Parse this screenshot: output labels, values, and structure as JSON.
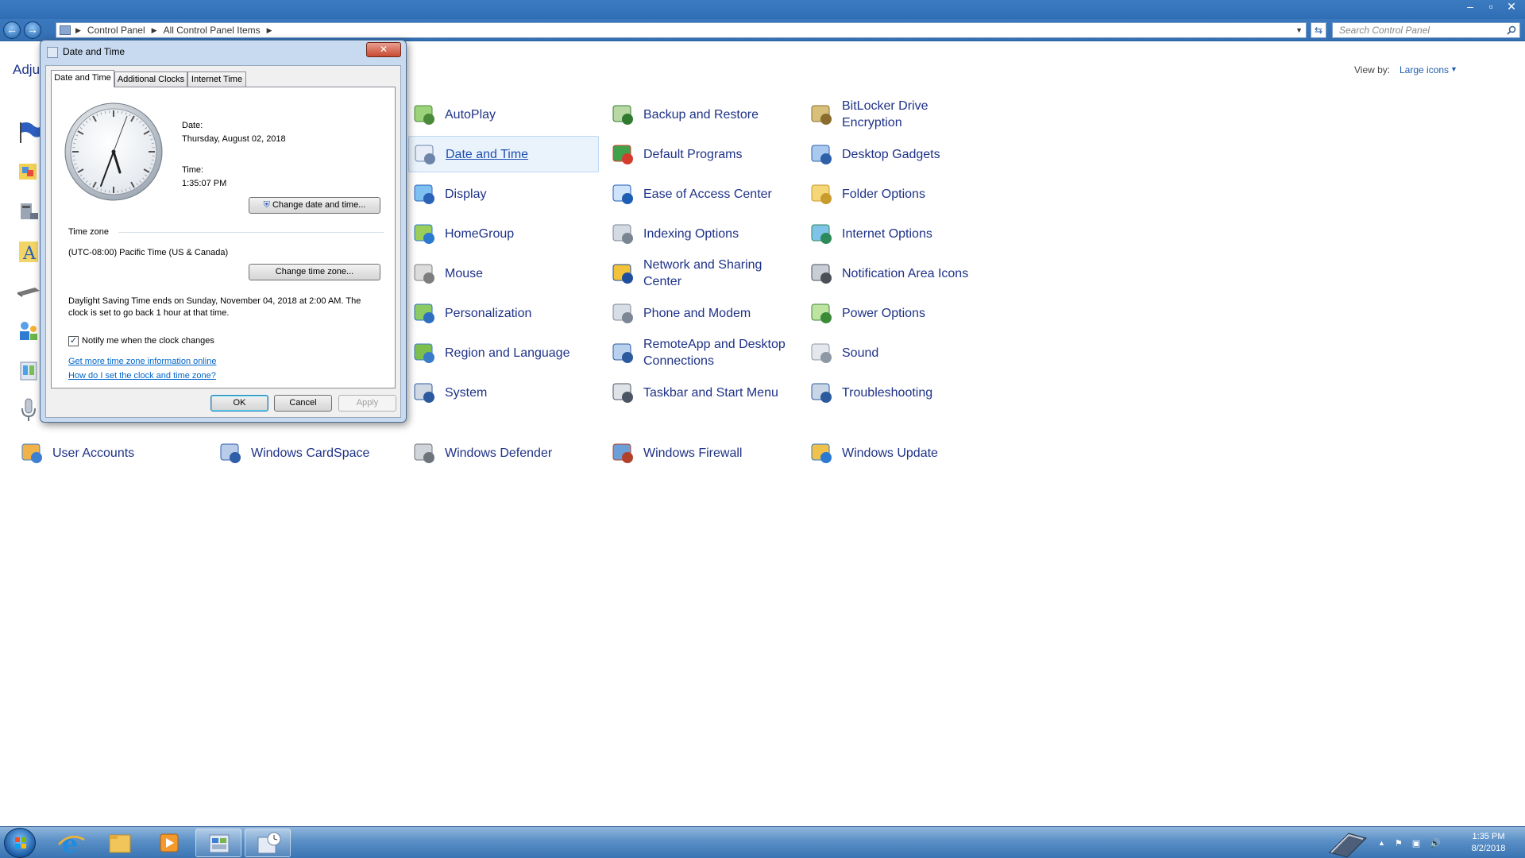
{
  "window": {
    "controls": [
      "–",
      "▫",
      "✕"
    ]
  },
  "navbar": {
    "breadcrumbs": [
      "Control Panel",
      "All Control Panel Items"
    ],
    "search_placeholder": "Search Control Panel"
  },
  "content": {
    "heading": "Adju",
    "view_by_label": "View by:",
    "view_by_value": "Large icons",
    "items": [
      {
        "label": "AutoPlay",
        "icon": "autoplay-icon"
      },
      {
        "label": "Backup and Restore",
        "icon": "backup-restore-icon"
      },
      {
        "label": "BitLocker Drive Encryption",
        "icon": "bitlocker-icon"
      },
      {
        "label": "Date and Time",
        "icon": "date-time-icon",
        "selected": true
      },
      {
        "label": "Default Programs",
        "icon": "default-programs-icon"
      },
      {
        "label": "Desktop Gadgets",
        "icon": "desktop-gadgets-icon"
      },
      {
        "label": "Display",
        "icon": "display-icon"
      },
      {
        "label": "Ease of Access Center",
        "icon": "ease-of-access-icon"
      },
      {
        "label": "Folder Options",
        "icon": "folder-options-icon"
      },
      {
        "label": "HomeGroup",
        "icon": "homegroup-icon"
      },
      {
        "label": "Indexing Options",
        "icon": "indexing-options-icon"
      },
      {
        "label": "Internet Options",
        "icon": "internet-options-icon"
      },
      {
        "label": "Mouse",
        "icon": "mouse-icon"
      },
      {
        "label": "Network and Sharing Center",
        "icon": "network-sharing-icon"
      },
      {
        "label": "Notification Area Icons",
        "icon": "notification-area-icon"
      },
      {
        "label": "Personalization",
        "icon": "personalization-icon"
      },
      {
        "label": "Phone and Modem",
        "icon": "phone-modem-icon"
      },
      {
        "label": "Power Options",
        "icon": "power-options-icon"
      },
      {
        "label": "Region and Language",
        "icon": "region-language-icon"
      },
      {
        "label": "RemoteApp and Desktop Connections",
        "icon": "remoteapp-icon"
      },
      {
        "label": "Sound",
        "icon": "sound-icon"
      },
      {
        "label": "System",
        "icon": "system-icon"
      },
      {
        "label": "Taskbar and Start Menu",
        "icon": "taskbar-start-menu-icon"
      },
      {
        "label": "Troubleshooting",
        "icon": "troubleshooting-icon"
      },
      {
        "label": "User Accounts",
        "icon": "user-accounts-icon"
      },
      {
        "label": "Windows CardSpace",
        "icon": "windows-cardspace-icon"
      },
      {
        "label": "Windows Defender",
        "icon": "windows-defender-icon"
      },
      {
        "label": "Windows Firewall",
        "icon": "windows-firewall-icon"
      },
      {
        "label": "Windows Update",
        "icon": "windows-update-icon"
      }
    ]
  },
  "dialog": {
    "title": "Date and Time",
    "close": "✕",
    "tabs": [
      "Date and Time",
      "Additional Clocks",
      "Internet Time"
    ],
    "date_label": "Date:",
    "date_value": "Thursday, August 02, 2018",
    "time_label": "Time:",
    "time_value": "1:35:07 PM",
    "change_datetime_button": "Change date and time...",
    "timezone_header": "Time zone",
    "timezone_value": "(UTC-08:00) Pacific Time (US & Canada)",
    "change_timezone_button": "Change time zone...",
    "dst_line1": "Daylight Saving Time ends on Sunday, November 04, 2018 at 2:00 AM. The",
    "dst_line2": "clock is set to go back 1 hour at that time.",
    "notify_label": "Notify me when the clock changes",
    "notify_checked": true,
    "link_more_info": "Get more time zone information online",
    "link_how_to": "How do I set the clock and time zone?",
    "ok_button": "OK",
    "cancel_button": "Cancel",
    "apply_button": "Apply"
  },
  "taskbar": {
    "clock_time": "1:35 PM",
    "clock_date": "8/2/2018",
    "tray_arrow": "▲"
  },
  "colors": {
    "link_blue": "#1e3287",
    "taskbar_blue": "#3a74b3",
    "titlebar_blue": "#2f6db4"
  }
}
